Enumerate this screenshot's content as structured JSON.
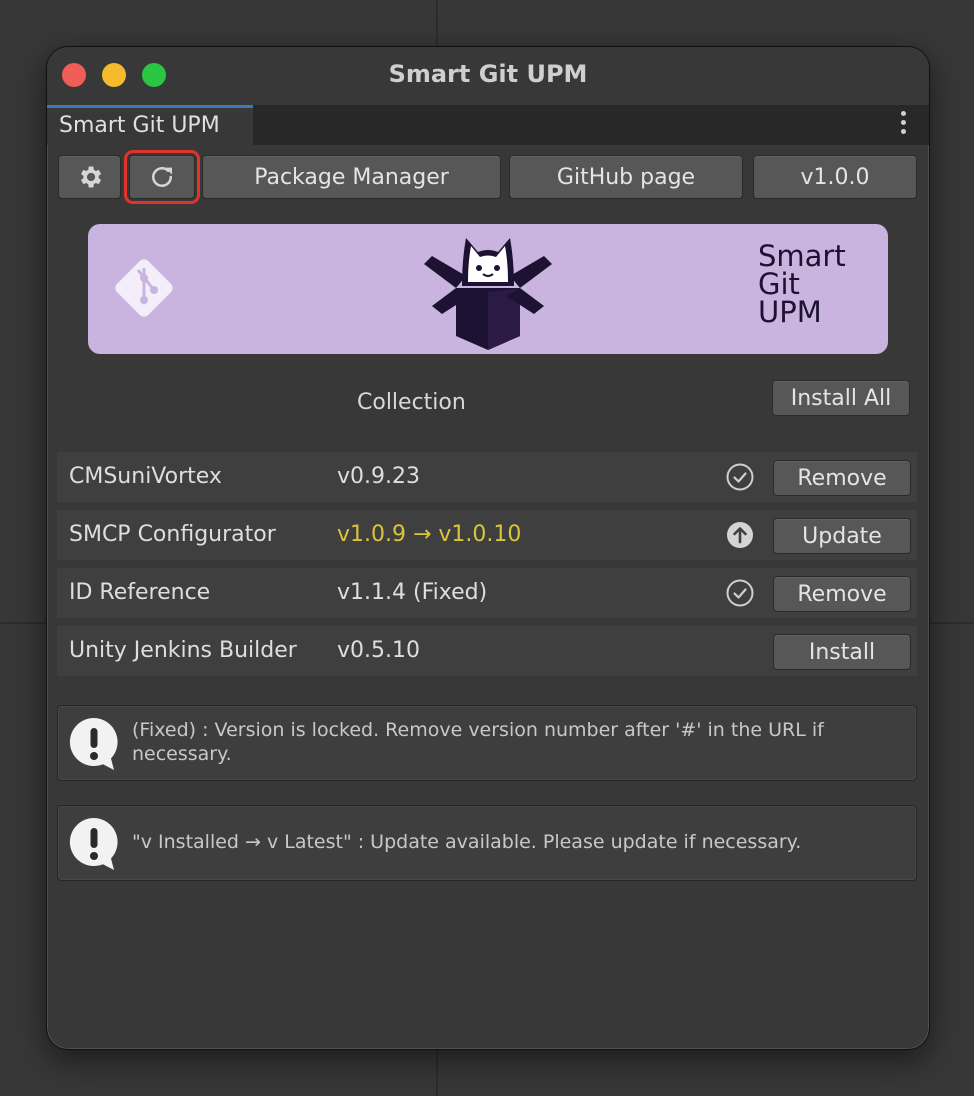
{
  "window": {
    "title": "Smart Git UPM",
    "tab_label": "Smart Git UPM"
  },
  "toolbar": {
    "settings_icon": "gear-icon",
    "refresh_icon": "refresh-icon",
    "package_manager_label": "Package Manager",
    "github_label": "GitHub page",
    "version_label": "v1.0.0"
  },
  "banner": {
    "line1": "Smart",
    "line2": "Git",
    "line3": "UPM",
    "background": "#c8b4df"
  },
  "collection": {
    "label": "Collection",
    "install_all_label": "Install All"
  },
  "packages": [
    {
      "name": "CMSuniVortex",
      "version": "v0.9.23",
      "status_icon": "check-circle-icon",
      "action": "Remove"
    },
    {
      "name": "SMCP Configurator",
      "version": "v1.0.9 → v1.0.10",
      "status_icon": "arrow-up-circle-icon",
      "action": "Update"
    },
    {
      "name": "ID Reference",
      "version": "v1.1.4 (Fixed)",
      "status_icon": "check-circle-icon",
      "action": "Remove"
    },
    {
      "name": "Unity Jenkins Builder",
      "version": "v0.5.10",
      "status_icon": "",
      "action": "Install"
    }
  ],
  "help": [
    {
      "text": "(Fixed) : Version is locked. Remove version number after '#' in the URL if necessary."
    },
    {
      "text": "\"v Installed → v Latest\" : Update available. Please update if necessary."
    }
  ],
  "colors": {
    "update_version": "#d9c53a",
    "highlight_outline": "#e0342a",
    "tab_accent": "#3a79bb"
  }
}
